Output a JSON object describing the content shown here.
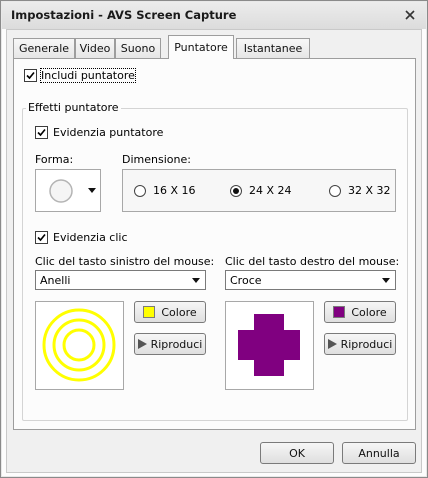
{
  "window": {
    "title": "Impostazioni - AVS Screen Capture",
    "close_icon": "close-icon"
  },
  "tabs": [
    {
      "label": "Generale",
      "active": false
    },
    {
      "label": "Video",
      "active": false
    },
    {
      "label": "Suono",
      "active": false
    },
    {
      "label": "Puntatore",
      "active": true
    },
    {
      "label": "Istantanee",
      "active": false
    }
  ],
  "pointer": {
    "include_label": "Includi puntatore",
    "include_checked": true,
    "effects_group_title": "Effetti puntatore",
    "highlight_label": "Evidenzia puntatore",
    "highlight_checked": true,
    "shape_label": "Forma:",
    "shape_icon": "circle-shape-icon",
    "dimension_label": "Dimensione:",
    "dimensions": [
      {
        "label": "16 X 16",
        "selected": false
      },
      {
        "label": "24 X 24",
        "selected": true
      },
      {
        "label": "32 X 32",
        "selected": false
      }
    ],
    "click_highlight_label": "Evidenzia clic",
    "click_highlight_checked": true
  },
  "left_click": {
    "label": "Clic del tasto sinistro del mouse:",
    "value": "Anelli",
    "color_hex": "#ffff00",
    "color_button": "Colore",
    "play_button": "Riproduci"
  },
  "right_click": {
    "label": "Clic del tasto destro del mouse:",
    "value": "Croce",
    "color_hex": "#800080",
    "color_button": "Colore",
    "play_button": "Riproduci"
  },
  "footer": {
    "ok_label": "OK",
    "cancel_label": "Annulla"
  }
}
